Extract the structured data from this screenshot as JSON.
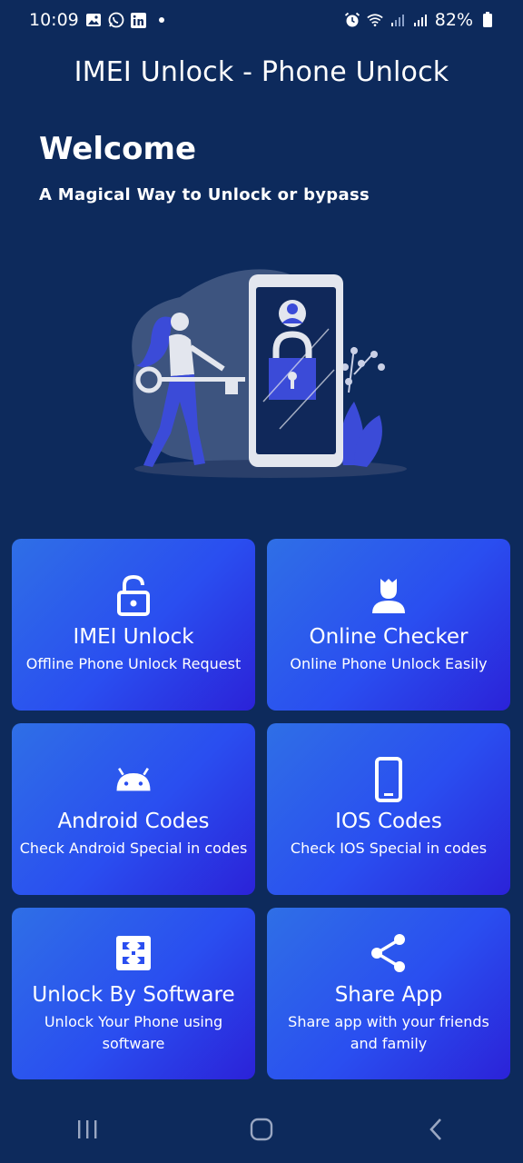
{
  "status": {
    "time": "10:09",
    "battery": "82%",
    "icons": [
      "gallery-icon",
      "whatsapp-icon",
      "linkedin-icon",
      "dot-icon",
      "alarm-icon",
      "wifi-icon",
      "signal-icon",
      "signal-icon",
      "battery-icon"
    ]
  },
  "app": {
    "title": "IMEI Unlock - Phone Unlock"
  },
  "hero": {
    "welcome": "Welcome",
    "tagline": "A Magical Way to Unlock or bypass"
  },
  "cards": [
    {
      "icon": "padlock-icon",
      "title": "IMEI Unlock",
      "subtitle": "Offline Phone Unlock Request"
    },
    {
      "icon": "user-icon",
      "title": "Online Checker",
      "subtitle": "Online Phone Unlock Easily"
    },
    {
      "icon": "android-icon",
      "title": "Android Codes",
      "subtitle": "Check Android Special in codes"
    },
    {
      "icon": "phone-icon",
      "title": "IOS Codes",
      "subtitle": "Check IOS Special in codes"
    },
    {
      "icon": "software-icon",
      "title": "Unlock By Software",
      "subtitle": "Unlock Your Phone using software"
    },
    {
      "icon": "share-icon",
      "title": "Share App",
      "subtitle": "Share app with your friends and family"
    }
  ],
  "colors": {
    "background": "#0d2a5c",
    "card_start": "#2f6fe6",
    "card_end": "#2b22d8"
  }
}
